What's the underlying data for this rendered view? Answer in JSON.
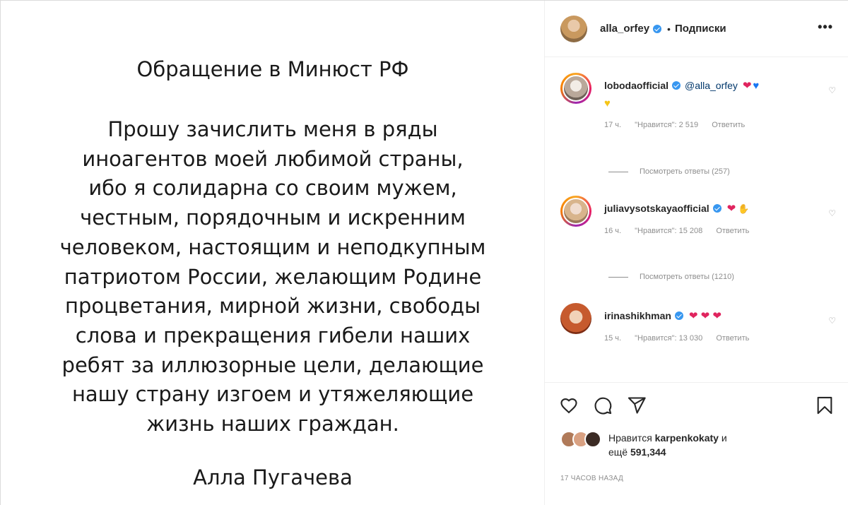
{
  "post_image": {
    "title": "Обращение в Минюст РФ",
    "body_lines": [
      "Прошу зачислить меня в ряды",
      "иноагентов моей любимой страны,",
      "ибо я солидарна со своим мужем,",
      "честным, порядочным и искренним",
      "человеком, настоящим и неподкупным",
      "патриотом России, желающим Родине",
      "процветания, мирной жизни, свободы",
      "слова и прекращения гибели наших",
      "ребят за иллюзорные цели, делающие",
      "нашу страну изгоем и утяжеляющие",
      "жизнь наших граждан."
    ],
    "signature": "Алла Пугачева"
  },
  "header": {
    "username": "alla_orfey",
    "separator": "•",
    "follow_label": "Подписки",
    "more_icon": "more-icon"
  },
  "comments": [
    {
      "username": "lobodaofficial",
      "mention": "@alla_orfey",
      "emoji_line1": [
        "❤",
        "💙"
      ],
      "emoji_line2": "💛",
      "time": "17 ч.",
      "likes": "\"Нравится\": 2 519",
      "reply": "Ответить",
      "view_replies": "Посмотреть ответы (257)"
    },
    {
      "username": "juliavysotskayaofficial",
      "emoji": "❤",
      "emoji2": "🙌",
      "time": "16 ч.",
      "likes": "\"Нравится\": 15 208",
      "reply": "Ответить",
      "view_replies": "Посмотреть ответы (1210)"
    },
    {
      "username": "irinashikhman",
      "emoji": "❤ ❤ ❤",
      "time": "15 ч.",
      "likes": "\"Нравится\": 13 030",
      "reply": "Ответить"
    }
  ],
  "actions": {
    "like_icon": "heart-outline-icon",
    "comment_icon": "comment-bubble-icon",
    "share_icon": "paper-plane-icon",
    "save_icon": "bookmark-icon"
  },
  "likes": {
    "prefix": "Нравится",
    "user": "karpenkokaty",
    "suffix": "и",
    "more_prefix": "ещё",
    "count": "591,344"
  },
  "timestamp": "17 ЧАСОВ НАЗАД",
  "colors": {
    "verified": "#3897f0",
    "heart_red": "#e0245e",
    "meta_gray": "#8e8e8e",
    "text": "#262626"
  }
}
